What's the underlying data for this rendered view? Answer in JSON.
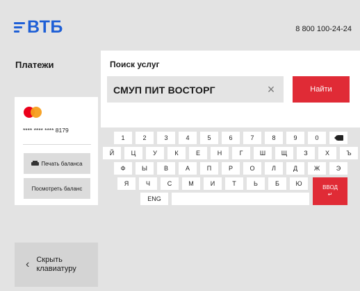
{
  "header": {
    "brand": "ВТБ",
    "phone": "8 800 100-24-24"
  },
  "sidebar": {
    "title": "Платежи",
    "card": {
      "logo": "mastercard-logo",
      "number": "**** **** **** 8179",
      "print_balance_label": "Печать баланса",
      "view_balance_label": "Посмотреть баланс"
    },
    "hide_keyboard_label": "Скрыть клавиатуру"
  },
  "search": {
    "title": "Поиск услуг",
    "value": "СМУП ПИТ ВОСТОРГ",
    "clear_symbol": "×",
    "find_label": "Найти"
  },
  "keyboard": {
    "row1": [
      "1",
      "2",
      "3",
      "4",
      "5",
      "6",
      "7",
      "8",
      "9",
      "0"
    ],
    "row2": [
      "Й",
      "Ц",
      "У",
      "К",
      "Е",
      "Н",
      "Г",
      "Ш",
      "Щ",
      "З",
      "Х",
      "Ъ"
    ],
    "row3": [
      "Ф",
      "Ы",
      "В",
      "А",
      "П",
      "Р",
      "О",
      "Л",
      "Д",
      "Ж",
      "Э"
    ],
    "row4": [
      "Я",
      "Ч",
      "С",
      "М",
      "И",
      "Т",
      "Ь",
      "Б",
      "Ю"
    ],
    "lang_label": "ENG",
    "enter_label": "ВВОД",
    "enter_arrow": "↵"
  },
  "colors": {
    "brand_blue": "#1e5fd6",
    "accent_red": "#e02b36",
    "background": "#e3e3e3"
  }
}
